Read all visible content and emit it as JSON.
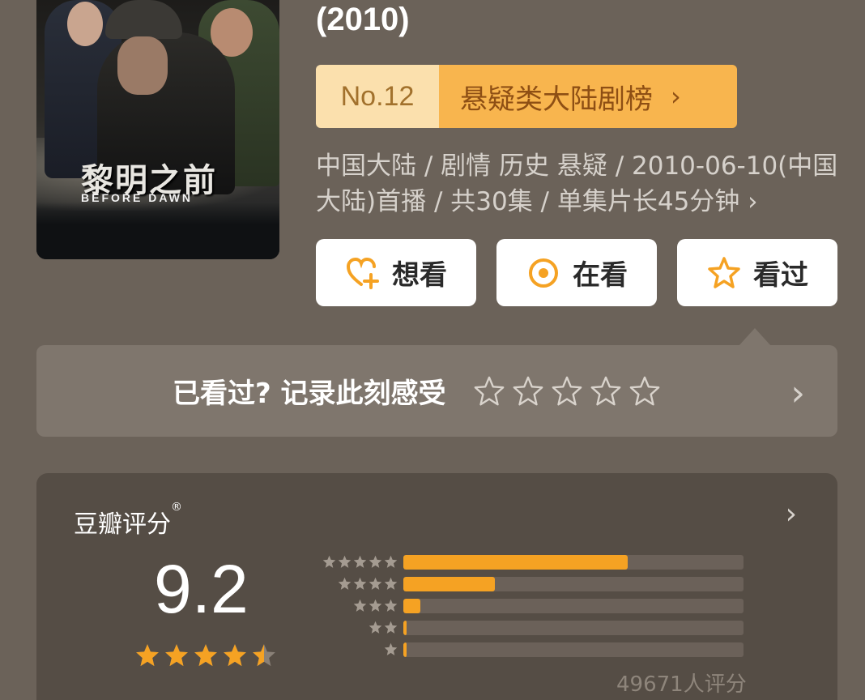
{
  "header": {
    "year": "(2010)"
  },
  "ranking": {
    "number": "No.12",
    "list_name": "悬疑类大陆剧榜",
    "arrow": "›"
  },
  "meta": {
    "info": "中国大陆 / 剧情 历史 悬疑 / 2010-06-10(中国大陆)首播 / 共30集 / 单集片长45分钟 ›"
  },
  "actions": {
    "want": "想看",
    "watching": "在看",
    "watched": "看过"
  },
  "prompt": {
    "text": "已看过? 记录此刻感受"
  },
  "rating": {
    "title": "豆瓣评分",
    "registered": "®",
    "score": "9.2",
    "stars_filled": 4.5,
    "distribution_percent": [
      66,
      27,
      5,
      1,
      1
    ],
    "count_text": "49671人评分"
  },
  "poster": {
    "title": "黎明之前",
    "subtitle": "BEFORE DAWN"
  },
  "colors": {
    "accent": "#f5a223",
    "background": "#6b6259",
    "card": "#554d45"
  }
}
